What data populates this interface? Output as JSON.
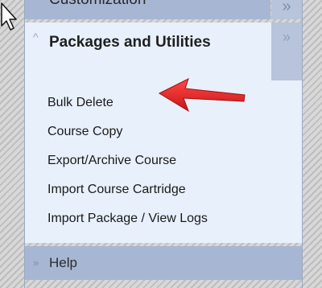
{
  "previous_section": {
    "label": "Customization",
    "chevron": "»"
  },
  "current_section": {
    "title": "Packages and Utilities",
    "collapse_chevron": "^",
    "expand_chevron": "»",
    "items": [
      {
        "label": "Bulk Delete"
      },
      {
        "label": "Course Copy"
      },
      {
        "label": "Export/Archive Course"
      },
      {
        "label": "Import Course Cartridge"
      },
      {
        "label": "Import Package / View Logs"
      }
    ]
  },
  "help": {
    "label": "Help",
    "chevron": "»"
  },
  "colors": {
    "panel_bg": "#e8f0fb",
    "bar_bg": "#a7b7d3",
    "arrow": "#e01d1d"
  },
  "icons": [
    "mouse-cursor-icon",
    "red-arrow-annotation",
    "chevron-up-icon",
    "chevron-right-icon",
    "chevron-down-icon"
  ]
}
